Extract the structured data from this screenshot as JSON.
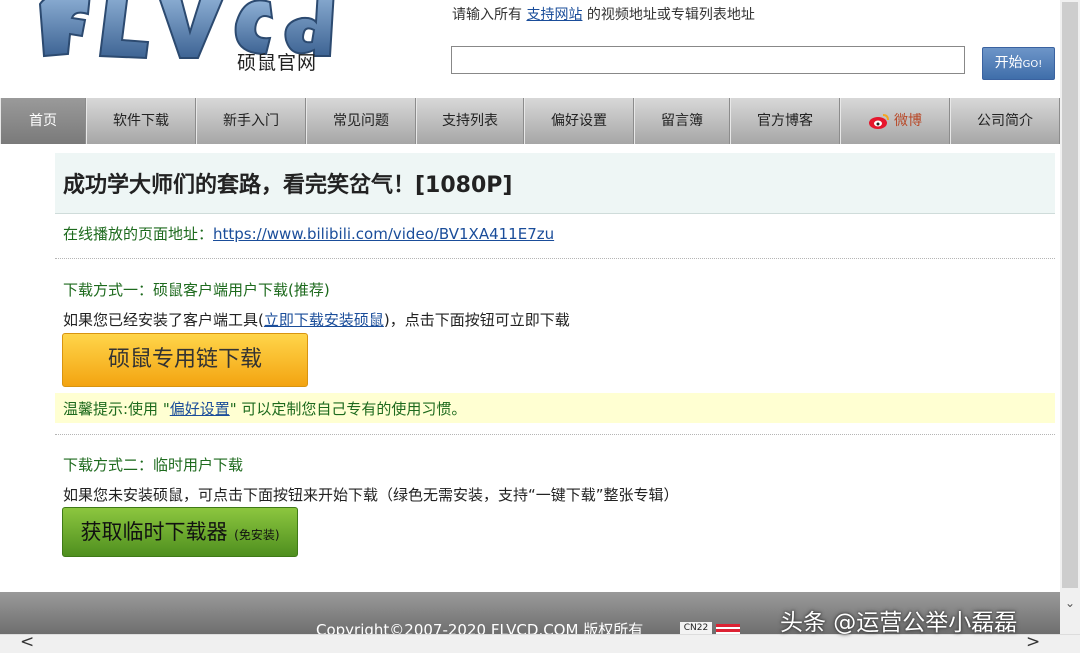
{
  "header": {
    "logo_sub": "硕鼠官网",
    "hint_prefix": "请输入所有",
    "hint_link": "支持网站",
    "hint_suffix": "的视频地址或专辑列表地址",
    "url_value": "",
    "go_label": "开始",
    "go_small": "GO!"
  },
  "nav": {
    "items": [
      {
        "label": "首页"
      },
      {
        "label": "软件下载"
      },
      {
        "label": "新手入门"
      },
      {
        "label": "常见问题"
      },
      {
        "label": "支持列表"
      },
      {
        "label": "偏好设置"
      },
      {
        "label": "留言簿"
      },
      {
        "label": "官方博客"
      },
      {
        "label": "微博"
      },
      {
        "label": "公司简介"
      }
    ]
  },
  "main": {
    "title": "成功学大师们的套路，看完笑岔气！[1080P]",
    "online_label": "在线播放的页面地址：",
    "online_url": "https://www.bilibili.com/video/BV1XA411E7zu",
    "method1_label": "下载方式一：硕鼠客户端用户下载(推荐)",
    "method1_desc_prefix": "如果您已经安装了客户端工具(",
    "method1_desc_link": "立即下载安装硕鼠",
    "method1_desc_suffix": ")，点击下面按钮可立即下载",
    "method1_button": "硕鼠专用链下载",
    "tip_prefix": "温馨提示:使用 \"",
    "tip_link": "偏好设置",
    "tip_suffix": "\" 可以定制您自己专有的使用习惯。",
    "method2_label": "下载方式二：临时用户下载",
    "method2_desc": "如果您未安装硕鼠，可点击下面按钮来开始下载（绿色无需安装，支持“一键下载”整张专辑）",
    "method2_button": "获取临时下载器",
    "method2_button_small": "(免安装)"
  },
  "footer": {
    "copyright": "Copyright©2007-2020 FLVCD.COM 版权所有",
    "badge": "CN22"
  },
  "watermark": "头条 @运营公举小磊磊",
  "colors": {
    "nav_active": "#8a8a8a",
    "link": "#1a4d9a",
    "green_text": "#1d6a1d",
    "yellow_button": "#f7b827",
    "green_button": "#6aa82c",
    "tip_bg": "#ffffd2"
  }
}
